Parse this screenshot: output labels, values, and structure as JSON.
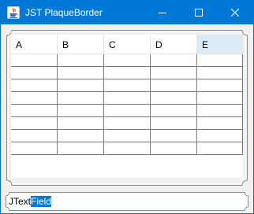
{
  "window": {
    "title": "JST PlaqueBorder",
    "accent_color": "#0078d7",
    "controls": [
      "minimize-icon",
      "maximize-icon",
      "close-icon"
    ]
  },
  "table": {
    "columns": [
      "A",
      "B",
      "C",
      "D",
      "E"
    ],
    "selected_column": "E",
    "row_count": 8,
    "rows": [
      [
        "",
        "",
        "",
        "",
        ""
      ],
      [
        "",
        "",
        "",
        "",
        ""
      ],
      [
        "",
        "",
        "",
        "",
        ""
      ],
      [
        "",
        "",
        "",
        "",
        ""
      ],
      [
        "",
        "",
        "",
        "",
        ""
      ],
      [
        "",
        "",
        "",
        "",
        ""
      ],
      [
        "",
        "",
        "",
        "",
        ""
      ],
      [
        "",
        "",
        "",
        "",
        ""
      ]
    ]
  },
  "textfield": {
    "value_unselected": "JText",
    "value_selected": "Field"
  }
}
